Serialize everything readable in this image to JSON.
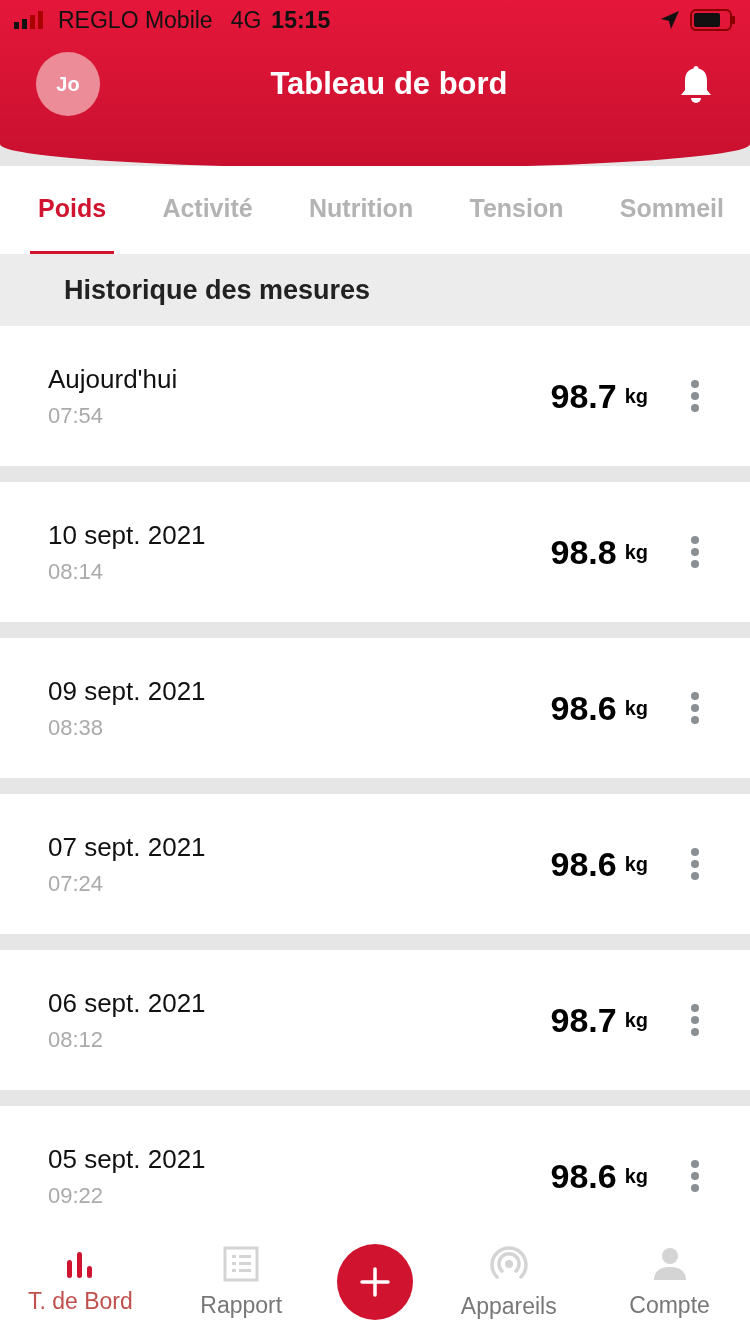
{
  "status_bar": {
    "carrier": "REGLO Mobile",
    "network": "4G",
    "time": "15:15"
  },
  "header": {
    "avatar": "Jo",
    "title": "Tableau de bord"
  },
  "tabs": [
    {
      "label": "Poids",
      "selected": true
    },
    {
      "label": "Activité",
      "selected": false
    },
    {
      "label": "Nutrition",
      "selected": false
    },
    {
      "label": "Tension",
      "selected": false
    },
    {
      "label": "Sommeil",
      "selected": false
    }
  ],
  "section_title": "Historique des mesures",
  "measurements": [
    {
      "date": "Aujourd'hui",
      "time": "07:54",
      "value": "98.7",
      "unit": "kg"
    },
    {
      "date": "10 sept. 2021",
      "time": "08:14",
      "value": "98.8",
      "unit": "kg"
    },
    {
      "date": "09 sept. 2021",
      "time": "08:38",
      "value": "98.6",
      "unit": "kg"
    },
    {
      "date": "07 sept. 2021",
      "time": "07:24",
      "value": "98.6",
      "unit": "kg"
    },
    {
      "date": "06 sept. 2021",
      "time": "08:12",
      "value": "98.7",
      "unit": "kg"
    },
    {
      "date": "05 sept. 2021",
      "time": "09:22",
      "value": "98.6",
      "unit": "kg"
    }
  ],
  "bottom_nav": [
    {
      "kind": "chart",
      "label": "T. de Bord",
      "selected": true
    },
    {
      "kind": "report",
      "label": "Rapport",
      "selected": false
    },
    {
      "kind": "add"
    },
    {
      "kind": "devices",
      "label": "Appareils",
      "selected": false
    },
    {
      "kind": "account",
      "label": "Compte",
      "selected": false
    }
  ]
}
